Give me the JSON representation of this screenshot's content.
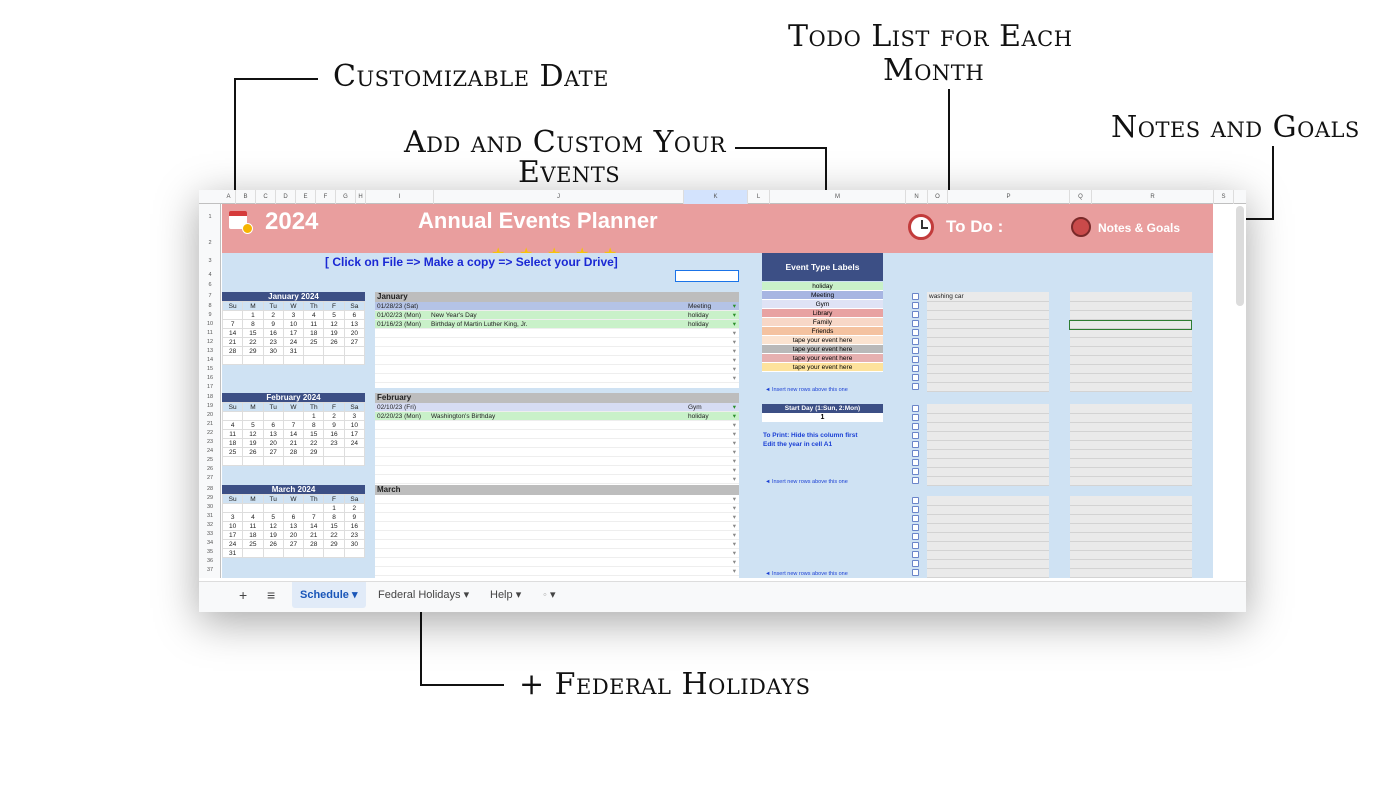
{
  "callouts": {
    "date": "Customizable Date",
    "events_1": "Add and Custom Your",
    "events_2": "Events",
    "todo_1": "Todo List for Each",
    "todo_2": "Month",
    "notes": "Notes and Goals",
    "holidays": "+ Federal Holidays"
  },
  "header": {
    "year": "2024",
    "title": "Annual Events Planner",
    "todo": "To Do :",
    "notes": "Notes & Goals",
    "copy_hint": "[ Click on File => Make a copy => Select your Drive]"
  },
  "columns": [
    "A",
    "B",
    "C",
    "D",
    "E",
    "F",
    "G",
    "H",
    "I",
    "J",
    "K",
    "L",
    "M",
    "N",
    "O",
    "P",
    "Q",
    "R",
    "S"
  ],
  "rows": [
    "1",
    "2",
    "3",
    "4",
    "6",
    "7",
    "8",
    "9",
    "10",
    "11",
    "12",
    "13",
    "14",
    "15",
    "16",
    "17",
    "18",
    "19",
    "20",
    "21",
    "22",
    "23",
    "24",
    "25",
    "26",
    "27",
    "28",
    "29",
    "30",
    "31",
    "32",
    "33",
    "34",
    "35",
    "36",
    "37"
  ],
  "dow": [
    "Su",
    "M",
    "Tu",
    "W",
    "Th",
    "F",
    "Sa"
  ],
  "calendars": [
    {
      "title": "January 2024",
      "weeks": [
        [
          "",
          "1",
          "2",
          "3",
          "4",
          "5",
          "6"
        ],
        [
          "7",
          "8",
          "9",
          "10",
          "11",
          "12",
          "13"
        ],
        [
          "14",
          "15",
          "16",
          "17",
          "18",
          "19",
          "20"
        ],
        [
          "21",
          "22",
          "23",
          "24",
          "25",
          "26",
          "27"
        ],
        [
          "28",
          "29",
          "30",
          "31",
          "",
          "",
          ""
        ]
      ]
    },
    {
      "title": "February 2024",
      "weeks": [
        [
          "",
          "",
          "",
          "",
          "1",
          "2",
          "3"
        ],
        [
          "4",
          "5",
          "6",
          "7",
          "8",
          "9",
          "10"
        ],
        [
          "11",
          "12",
          "13",
          "14",
          "15",
          "16",
          "17"
        ],
        [
          "18",
          "19",
          "20",
          "21",
          "22",
          "23",
          "24"
        ],
        [
          "25",
          "26",
          "27",
          "28",
          "29",
          "",
          ""
        ]
      ]
    },
    {
      "title": "March 2024",
      "weeks": [
        [
          "",
          "",
          "",
          "",
          "",
          "1",
          "2"
        ],
        [
          "3",
          "4",
          "5",
          "6",
          "7",
          "8",
          "9"
        ],
        [
          "10",
          "11",
          "12",
          "13",
          "14",
          "15",
          "16"
        ],
        [
          "17",
          "18",
          "19",
          "20",
          "21",
          "22",
          "23"
        ],
        [
          "24",
          "25",
          "26",
          "27",
          "28",
          "29",
          "30"
        ],
        [
          "31",
          "",
          "",
          "",
          "",
          "",
          ""
        ]
      ]
    }
  ],
  "event_months": [
    {
      "name": "January",
      "events": [
        {
          "date": "01/28/23 (Sat)",
          "name": "",
          "type": "Meeting",
          "color": "#b4c3e6"
        },
        {
          "date": "01/02/23 (Mon)",
          "name": "New Year's Day",
          "type": "holiday",
          "color": "#c9f1c9"
        },
        {
          "date": "01/16/23 (Mon)",
          "name": "Birthday of Martin Luther King, Jr.",
          "type": "holiday",
          "color": "#c9f1c9"
        }
      ]
    },
    {
      "name": "February",
      "events": [
        {
          "date": "02/10/23 (Fri)",
          "name": "",
          "type": "Gym",
          "color": "#d6dcf3"
        },
        {
          "date": "02/20/23 (Mon)",
          "name": "Washington's Birthday",
          "type": "holiday",
          "color": "#c9f1c9"
        }
      ]
    },
    {
      "name": "March",
      "events": []
    }
  ],
  "event_types": {
    "title": "Event Type Labels",
    "items": [
      {
        "label": "holiday",
        "color": "#c9f1c9"
      },
      {
        "label": "Meeting",
        "color": "#a7b5e2"
      },
      {
        "label": "Gym",
        "color": "#dfe3f5"
      },
      {
        "label": "Library",
        "color": "#e8a2a2"
      },
      {
        "label": "Family",
        "color": "#f7d7c7"
      },
      {
        "label": "Friends",
        "color": "#f4c2a0"
      },
      {
        "label": "tape your event here",
        "color": "#fbe3d0"
      },
      {
        "label": "tape your event here",
        "color": "#b9b9b9"
      },
      {
        "label": "tape your event here",
        "color": "#e6b0b0"
      },
      {
        "label": "tape your event here",
        "color": "#fde29c"
      }
    ],
    "insert_hint": "◄ Insert new rows above this one",
    "start_day_label": "Start Day (1:Sun, 2:Mon)",
    "start_day_value": "1",
    "print_hint_1": "To Print: Hide this column first",
    "print_hint_2": "Edit the year in cell A1"
  },
  "todo_first_item": "washing car",
  "tabs": {
    "add": "+",
    "list": "≡",
    "schedule": "Schedule",
    "federal": "Federal Holidays",
    "help": "Help",
    "more": "◦"
  },
  "colors": {
    "header": "#e99e9e",
    "body": "#cfe2f3",
    "calendar_title": "#3c4f85"
  }
}
